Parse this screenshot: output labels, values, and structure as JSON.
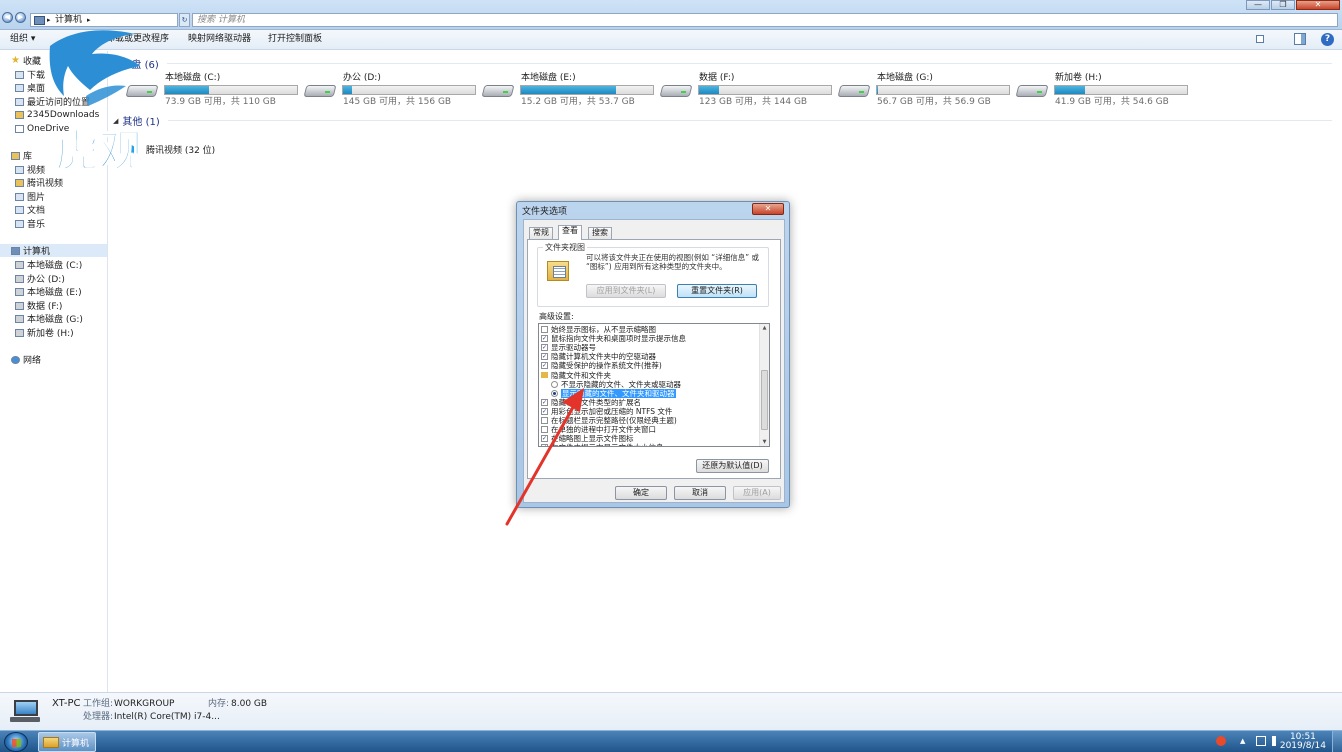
{
  "window": {
    "address": {
      "crumb": "计算机",
      "separator": "▸"
    },
    "search_placeholder": "搜索 计算机",
    "controls": {
      "minimize": "—",
      "maximize": "❐",
      "close": "✕"
    }
  },
  "toolbar": {
    "organize": "组织 ▾",
    "uninstall": "卸载或更改程序",
    "map_drive": "映射网络驱动器",
    "control_panel": "打开控制面板",
    "help": "?"
  },
  "navpane": {
    "favorites": {
      "label": "收藏",
      "items": [
        "下载",
        "桌面",
        "最近访问的位置",
        "2345Downloads",
        "OneDrive"
      ]
    },
    "libraries": {
      "label": "库",
      "items": [
        "视频",
        "腾讯视频",
        "图片",
        "文档",
        "音乐"
      ]
    },
    "computer": {
      "label": "计算机",
      "items": [
        "本地磁盘 (C:)",
        "办公 (D:)",
        "本地磁盘 (E:)",
        "数据 (F:)",
        "本地磁盘 (G:)",
        "新加卷 (H:)"
      ]
    },
    "network": {
      "label": "网络"
    }
  },
  "content": {
    "drives_group": "盘 (6)",
    "drives": [
      {
        "name": "本地磁盘 (C:)",
        "free": "73.9 GB 可用，共 110 GB",
        "used_fraction": 0.33
      },
      {
        "name": "办公 (D:)",
        "free": "145 GB 可用，共 156 GB",
        "used_fraction": 0.07
      },
      {
        "name": "本地磁盘 (E:)",
        "free": "15.2 GB 可用，共 53.7 GB",
        "used_fraction": 0.72
      },
      {
        "name": "数据 (F:)",
        "free": "123 GB 可用，共 144 GB",
        "used_fraction": 0.15
      },
      {
        "name": "本地磁盘 (G:)",
        "free": "56.7 GB 可用，共 56.9 GB",
        "used_fraction": 0.01
      },
      {
        "name": "新加卷 (H:)",
        "free": "41.9 GB 可用，共 54.6 GB",
        "used_fraction": 0.23
      }
    ],
    "other_group": "其他 (1)",
    "other_item": "腾讯视频 (32 位)"
  },
  "details": {
    "pc_name": "XT-PC",
    "workgroup_key": "工作组:",
    "workgroup_val": "WORKGROUP",
    "memory_key": "内存:",
    "memory_val": "8.00 GB",
    "cpu_key": "处理器:",
    "cpu_val": "Intel(R) Core(TM) i7-4..."
  },
  "taskbar": {
    "explorer_label": "计算机",
    "time": "10:51",
    "date": "2019/8/14"
  },
  "dialog": {
    "title": "文件夹选项",
    "close": "✕",
    "tabs": [
      "常规",
      "查看",
      "搜索"
    ],
    "folder_views": {
      "legend": "文件夹视图",
      "desc": "可以将该文件夹正在使用的视图(例如 “详细信息” 或 “图标”) 应用到所有这种类型的文件夹中。",
      "apply_btn": "应用到文件夹(L)",
      "reset_btn": "重置文件夹(R)"
    },
    "advanced_label": "高级设置:",
    "advanced_items": [
      {
        "type": "check",
        "checked": false,
        "text": "始终显示图标，从不显示缩略图"
      },
      {
        "type": "check",
        "checked": true,
        "text": "鼠标指向文件夹和桌面项时显示提示信息"
      },
      {
        "type": "check",
        "checked": true,
        "text": "显示驱动器号"
      },
      {
        "type": "check",
        "checked": true,
        "text": "隐藏计算机文件夹中的空驱动器"
      },
      {
        "type": "check",
        "checked": true,
        "text": "隐藏受保护的操作系统文件(推荐)"
      },
      {
        "type": "folder",
        "text": "隐藏文件和文件夹"
      },
      {
        "type": "radio",
        "checked": false,
        "text": "不显示隐藏的文件、文件夹或驱动器"
      },
      {
        "type": "radio",
        "checked": true,
        "selected": true,
        "text": "显示隐藏的文件、文件夹和驱动器"
      },
      {
        "type": "check",
        "checked": true,
        "text": "隐藏已知文件类型的扩展名"
      },
      {
        "type": "check",
        "checked": true,
        "text": "用彩色显示加密或压缩的 NTFS 文件"
      },
      {
        "type": "check",
        "checked": false,
        "text": "在标题栏显示完整路径(仅限经典主题)"
      },
      {
        "type": "check",
        "checked": false,
        "text": "在单独的进程中打开文件夹窗口"
      },
      {
        "type": "check",
        "checked": true,
        "text": "在缩略图上显示文件图标"
      },
      {
        "type": "check",
        "checked": true,
        "text": "在文件夹提示中显示文件大小信息"
      }
    ],
    "restore_btn": "还原为默认值(D)",
    "ok_btn": "确定",
    "cancel_btn": "取消",
    "apply_btn": "应用(A)"
  },
  "watermark": {
    "text": "虎观"
  },
  "colors": {
    "accent": "#1d89c1",
    "selection": "#3399ff",
    "arrow": "#e3342b",
    "logo": "#2c8fd6"
  }
}
